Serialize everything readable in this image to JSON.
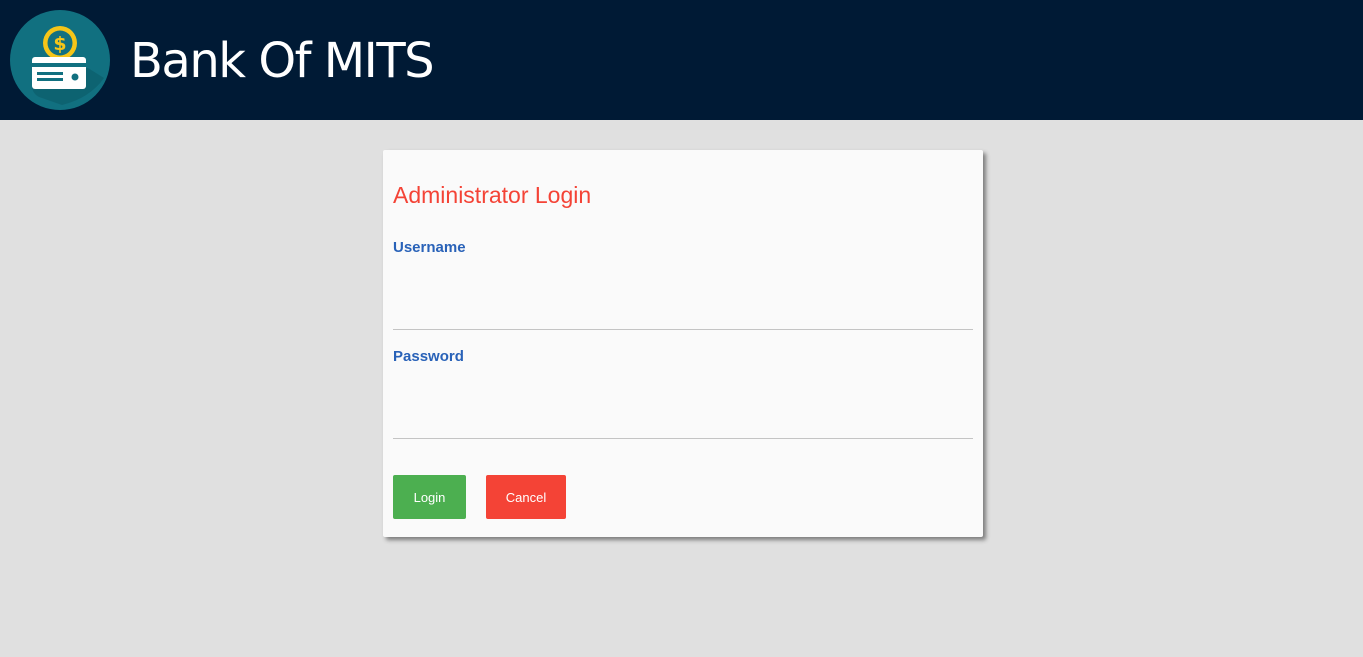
{
  "header": {
    "title": "Bank Of MITS",
    "logo_icon": "money-card-icon",
    "background": "#001a35"
  },
  "login_card": {
    "title": "Administrator Login",
    "username": {
      "label": "Username",
      "value": ""
    },
    "password": {
      "label": "Password",
      "value": ""
    },
    "login_button": "Login",
    "cancel_button": "Cancel"
  },
  "colors": {
    "title_red": "#f44336",
    "label_blue": "#2962b8",
    "login_green": "#4caf50",
    "cancel_red": "#f44336",
    "page_background": "#e0e0e0"
  }
}
